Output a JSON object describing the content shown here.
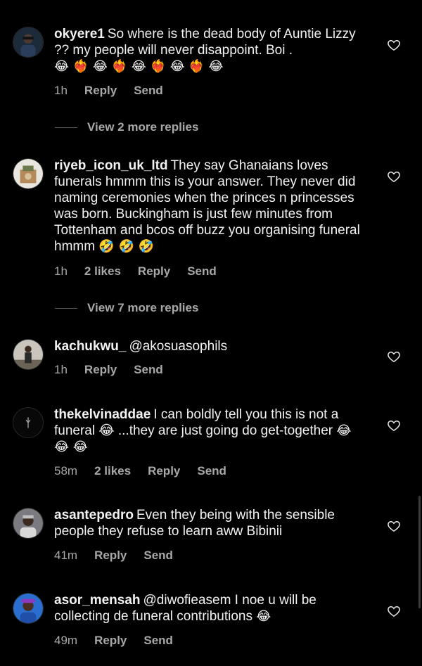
{
  "comments": [
    {
      "username": "okyere1",
      "text": "So where is the dead body of Auntie Lizzy ?? my people will never disappoint. Boi .",
      "emojis": "😂 ❤️‍🔥 😂 ❤️‍🔥 😂 ❤️‍🔥 😂 ❤️‍🔥 😂",
      "time": "1h",
      "likes": "",
      "reply": "Reply",
      "send": "Send",
      "avatar_icon": "avatar-photo-icon"
    },
    {
      "username": "riyeb_icon_uk_ltd",
      "text": "They say Ghanaians loves funerals hmmm this is your answer. They never did naming ceremonies when the princes n princesses was born. Buckingham is just few minutes from Tottenham and bcos off buzz you organising funeral hmmm",
      "emojis": "🤣 🤣 🤣",
      "time": "1h",
      "likes": "2 likes",
      "reply": "Reply",
      "send": "Send",
      "avatar_icon": "avatar-photo-icon"
    },
    {
      "username": "kachukwu_",
      "text": "@akosuasophils",
      "emojis": "",
      "time": "1h",
      "likes": "",
      "reply": "Reply",
      "send": "Send",
      "avatar_icon": "avatar-photo-icon"
    },
    {
      "username": "thekelvinaddae",
      "text": "I can boldly tell you this is not a funeral 😂 ...they are just going do get-together",
      "emojis": "😂 😂 😂",
      "time": "58m",
      "likes": "2 likes",
      "reply": "Reply",
      "send": "Send",
      "avatar_icon": "avatar-photo-icon"
    },
    {
      "username": "asantepedro",
      "text": "Even they being with the sensible people they refuse to learn aww Bibinii",
      "emojis": "",
      "time": "41m",
      "likes": "",
      "reply": "Reply",
      "send": "Send",
      "avatar_icon": "avatar-photo-icon"
    },
    {
      "username": "asor_mensah",
      "text": "@diwofieasem I noe u will be collecting de funeral contributions",
      "emojis": "😂",
      "time": "49m",
      "likes": "",
      "reply": "Reply",
      "send": "Send",
      "avatar_icon": "avatar-photo-icon"
    }
  ],
  "view_replies": [
    {
      "label": "View 2 more replies"
    },
    {
      "label": "View 7 more replies"
    }
  ],
  "colors": {
    "background": "#000000",
    "text": "#f2f2f2",
    "muted": "#a8a8a8"
  },
  "icons": {
    "like": "heart-outline-icon"
  }
}
